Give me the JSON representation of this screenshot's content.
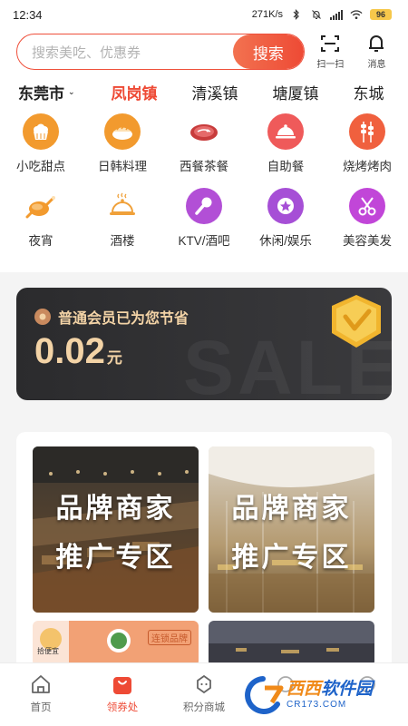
{
  "status_bar": {
    "time": "12:34",
    "net_speed": "271K/s",
    "battery": "96"
  },
  "header": {
    "search_placeholder": "搜索美吃、优惠券",
    "search_button": "搜索",
    "scan_label": "扫一扫",
    "message_label": "消息"
  },
  "location": {
    "city": "东莞市",
    "tabs": [
      {
        "label": "凤岗镇",
        "active": true
      },
      {
        "label": "清溪镇",
        "active": false
      },
      {
        "label": "塘厦镇",
        "active": false
      },
      {
        "label": "东城",
        "active": false
      }
    ]
  },
  "categories": [
    {
      "label": "小吃甜点",
      "icon": "cake-icon",
      "color": "#f29a2e"
    },
    {
      "label": "日韩料理",
      "icon": "sushi-icon",
      "color": "#f29a2e"
    },
    {
      "label": "西餐茶餐",
      "icon": "steak-icon",
      "color": "#d94545"
    },
    {
      "label": "自助餐",
      "icon": "cloche-icon",
      "color": "#ef5a5a"
    },
    {
      "label": "烧烤烤肉",
      "icon": "skewer-icon",
      "color": "#f0603e"
    },
    {
      "label": "夜宵",
      "icon": "roast-chicken-icon",
      "color": "#f29a2e"
    },
    {
      "label": "酒楼",
      "icon": "serving-dish-icon",
      "color": "#f0a13a"
    },
    {
      "label": "KTV/酒吧",
      "icon": "microphone-icon",
      "color": "#b24fd6"
    },
    {
      "label": "休闲/娱乐",
      "icon": "star-icon",
      "color": "#a64fd6"
    },
    {
      "label": "美容美发",
      "icon": "scissors-icon",
      "color": "#c146d8"
    }
  ],
  "member_card": {
    "title": "普通会员已为您节省",
    "amount": "0.02",
    "unit": "元",
    "bg_text": "SALE"
  },
  "promo": {
    "tiles": [
      {
        "line1": "品牌商家",
        "line2": "推广专区"
      },
      {
        "line1": "品牌商家",
        "line2": "推广专区"
      }
    ],
    "partial_tiles": [
      {
        "brand_text": "拾便宜",
        "tag": "连锁品牌"
      }
    ]
  },
  "bottom_nav": [
    {
      "label": "首页",
      "icon": "home-icon",
      "active": false
    },
    {
      "label": "领券处",
      "icon": "shopping-bag-icon",
      "active": true
    },
    {
      "label": "积分商城",
      "icon": "points-mall-icon",
      "active": false
    },
    {
      "label": "",
      "icon": "wallet-icon",
      "active": false
    },
    {
      "label": "",
      "icon": "profile-icon",
      "active": false
    }
  ],
  "watermark": {
    "text_a": "西西",
    "text_b": "软件园",
    "domain": "CR173.COM"
  },
  "colors": {
    "accent": "#ee4a35",
    "gold": "#f3d3a6",
    "card_dark": "#2b2b2d"
  }
}
